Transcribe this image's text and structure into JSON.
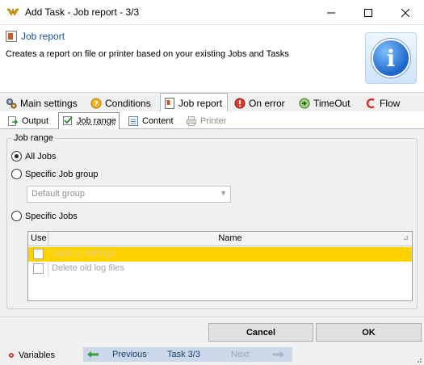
{
  "window": {
    "title": "Add Task - Job report - 3/3"
  },
  "header": {
    "title": "Job report",
    "description": "Creates a report on file or printer based on your existing Jobs and Tasks"
  },
  "main_tabs": [
    {
      "label": "Main settings",
      "icon": "gears-icon",
      "active": false
    },
    {
      "label": "Conditions",
      "icon": "conditions-icon",
      "active": false
    },
    {
      "label": "Job report",
      "icon": "job-report-icon",
      "active": true
    },
    {
      "label": "On error",
      "icon": "error-icon",
      "active": false
    },
    {
      "label": "TimeOut",
      "icon": "timeout-icon",
      "active": false
    },
    {
      "label": "Flow",
      "icon": "flow-icon",
      "active": false
    }
  ],
  "sub_tabs": [
    {
      "label": "Output",
      "icon": "output-icon",
      "active": false,
      "enabled": true
    },
    {
      "label": "Job range",
      "icon": "job-range-icon",
      "active": true,
      "enabled": true
    },
    {
      "label": "Content",
      "icon": "content-icon",
      "active": false,
      "enabled": true
    },
    {
      "label": "Printer",
      "icon": "printer-icon",
      "active": false,
      "enabled": false
    }
  ],
  "job_range": {
    "legend": "Job range",
    "options": [
      {
        "label": "All Jobs",
        "checked": true
      },
      {
        "label": "Specific Job group",
        "checked": false
      },
      {
        "label": "Specific Jobs",
        "checked": false
      }
    ],
    "group_combo": {
      "value": "Default group",
      "enabled": false
    },
    "grid": {
      "columns": [
        "Use",
        "Name"
      ],
      "rows": [
        {
          "use": false,
          "name": "Backup settings",
          "selected": true
        },
        {
          "use": false,
          "name": "Delete old log files",
          "selected": false
        }
      ]
    }
  },
  "buttons": {
    "cancel": "Cancel",
    "ok": "OK"
  },
  "statusbar": {
    "variables": "Variables",
    "previous": "Previous",
    "task_label": "Task 3/3",
    "next": "Next"
  },
  "colors": {
    "selected_row": "#ffd200",
    "header_title": "#1a4f9c",
    "nav_bar": "#cbd8ea"
  }
}
